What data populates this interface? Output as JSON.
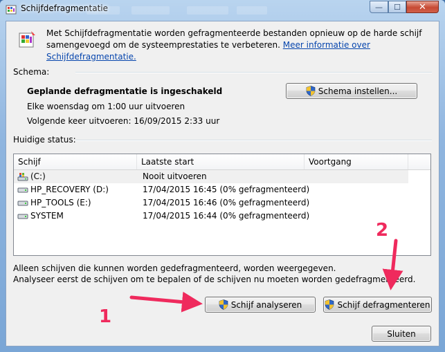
{
  "window": {
    "title": "Schijfdefragmentatie",
    "controls": {
      "minimize": "—",
      "maximize": "☐",
      "close": "✕"
    }
  },
  "intro": {
    "text": "Met Schijfdefragmentatie worden gefragmenteerde bestanden opnieuw op de harde schijf samengevoegd om de systeemprestaties te verbeteren.",
    "link": "Meer informatie over Schijfdefragmentatie."
  },
  "schedule": {
    "label": "Schema:",
    "status": "Geplande defragmentatie is ingeschakeld",
    "runs": "Elke woensdag om 1:00 uur uitvoeren",
    "next_run": "Volgende keer uitvoeren: 16/09/2015 2:33 uur",
    "configure_button": "Schema instellen..."
  },
  "current_status": {
    "label": "Huidige status:",
    "columns": [
      "Schijf",
      "Laatste start",
      "Voortgang"
    ],
    "rows": [
      {
        "disk": "(C:)",
        "last_start": "Nooit uitvoeren",
        "progress": "",
        "icon": "system-drive-icon"
      },
      {
        "disk": "HP_RECOVERY (D:)",
        "last_start": "17/04/2015 16:45 (0% gefragmenteerd)",
        "progress": "",
        "icon": "drive-icon"
      },
      {
        "disk": "HP_TOOLS (E:)",
        "last_start": "17/04/2015 16:46 (0% gefragmenteerd)",
        "progress": "",
        "icon": "drive-icon"
      },
      {
        "disk": "SYSTEM",
        "last_start": "17/04/2015 16:44 (0% gefragmenteerd)",
        "progress": "",
        "icon": "drive-icon"
      }
    ]
  },
  "notes": {
    "line1": "Alleen schijven die kunnen worden gedefragmenteerd, worden weergegeven.",
    "line2": "Analyseer eerst de schijven om te bepalen of de schijven nu moeten worden gedefragmenteerd."
  },
  "actions": {
    "analyze": "Schijf analyseren",
    "defragment": "Schijf defragmenteren",
    "close": "Sluiten"
  },
  "annotations": {
    "step1": "1",
    "step2": "2",
    "color": "#ef2a5d"
  }
}
